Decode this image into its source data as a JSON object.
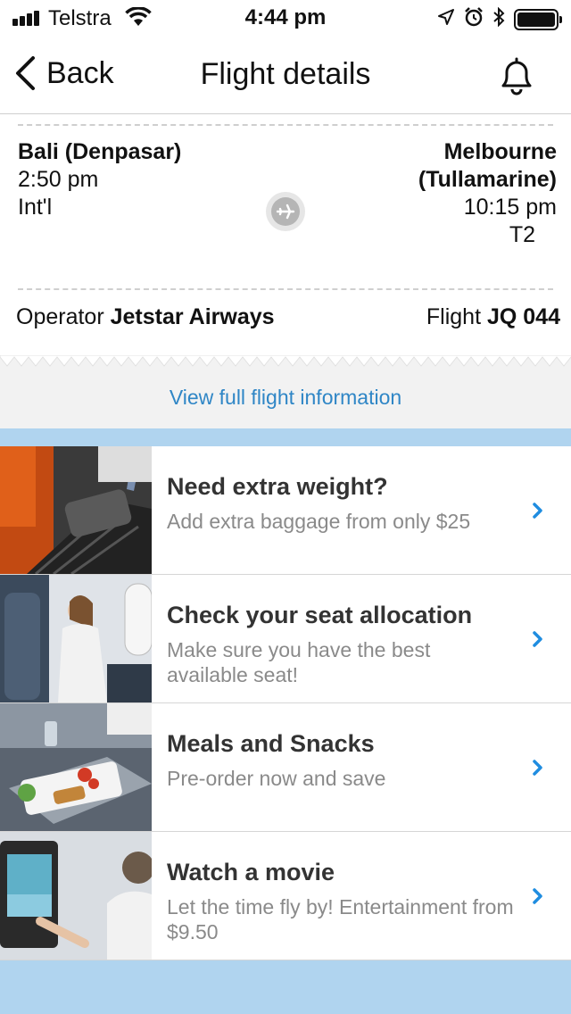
{
  "status_bar": {
    "carrier": "Telstra",
    "time": "4:44 pm",
    "battery_level": 1.0
  },
  "nav": {
    "back_label": "Back",
    "title": "Flight details"
  },
  "flight": {
    "origin": {
      "city": "Bali (Denpasar)",
      "time": "2:50 pm",
      "terminal": "Int'l"
    },
    "destination": {
      "city_line1": "Melbourne",
      "city_line2": "(Tullamarine)",
      "time": "10:15 pm",
      "terminal": "T2"
    },
    "operator_label": "Operator",
    "operator": "Jetstar Airways",
    "flight_label": "Flight",
    "flight_number": "JQ 044"
  },
  "view_full_info": "View full flight information",
  "promos": [
    {
      "title": "Need extra weight?",
      "subtitle": "Add extra baggage from only $25",
      "image": "luggage-carousel"
    },
    {
      "title": "Check your seat allocation",
      "subtitle": "Make sure you have the best available seat!",
      "image": "passenger-in-seat"
    },
    {
      "title": "Meals and Snacks",
      "subtitle": "Pre-order now and save",
      "image": "inflight-meal"
    },
    {
      "title": "Watch a movie",
      "subtitle": "Let the time fly by! Entertainment from $9.50",
      "image": "seatback-screen"
    }
  ],
  "colors": {
    "accent_link": "#2f86c6",
    "chevron": "#1f8de0",
    "list_background": "#b0d4ef",
    "band_background": "#f2f2f2"
  }
}
